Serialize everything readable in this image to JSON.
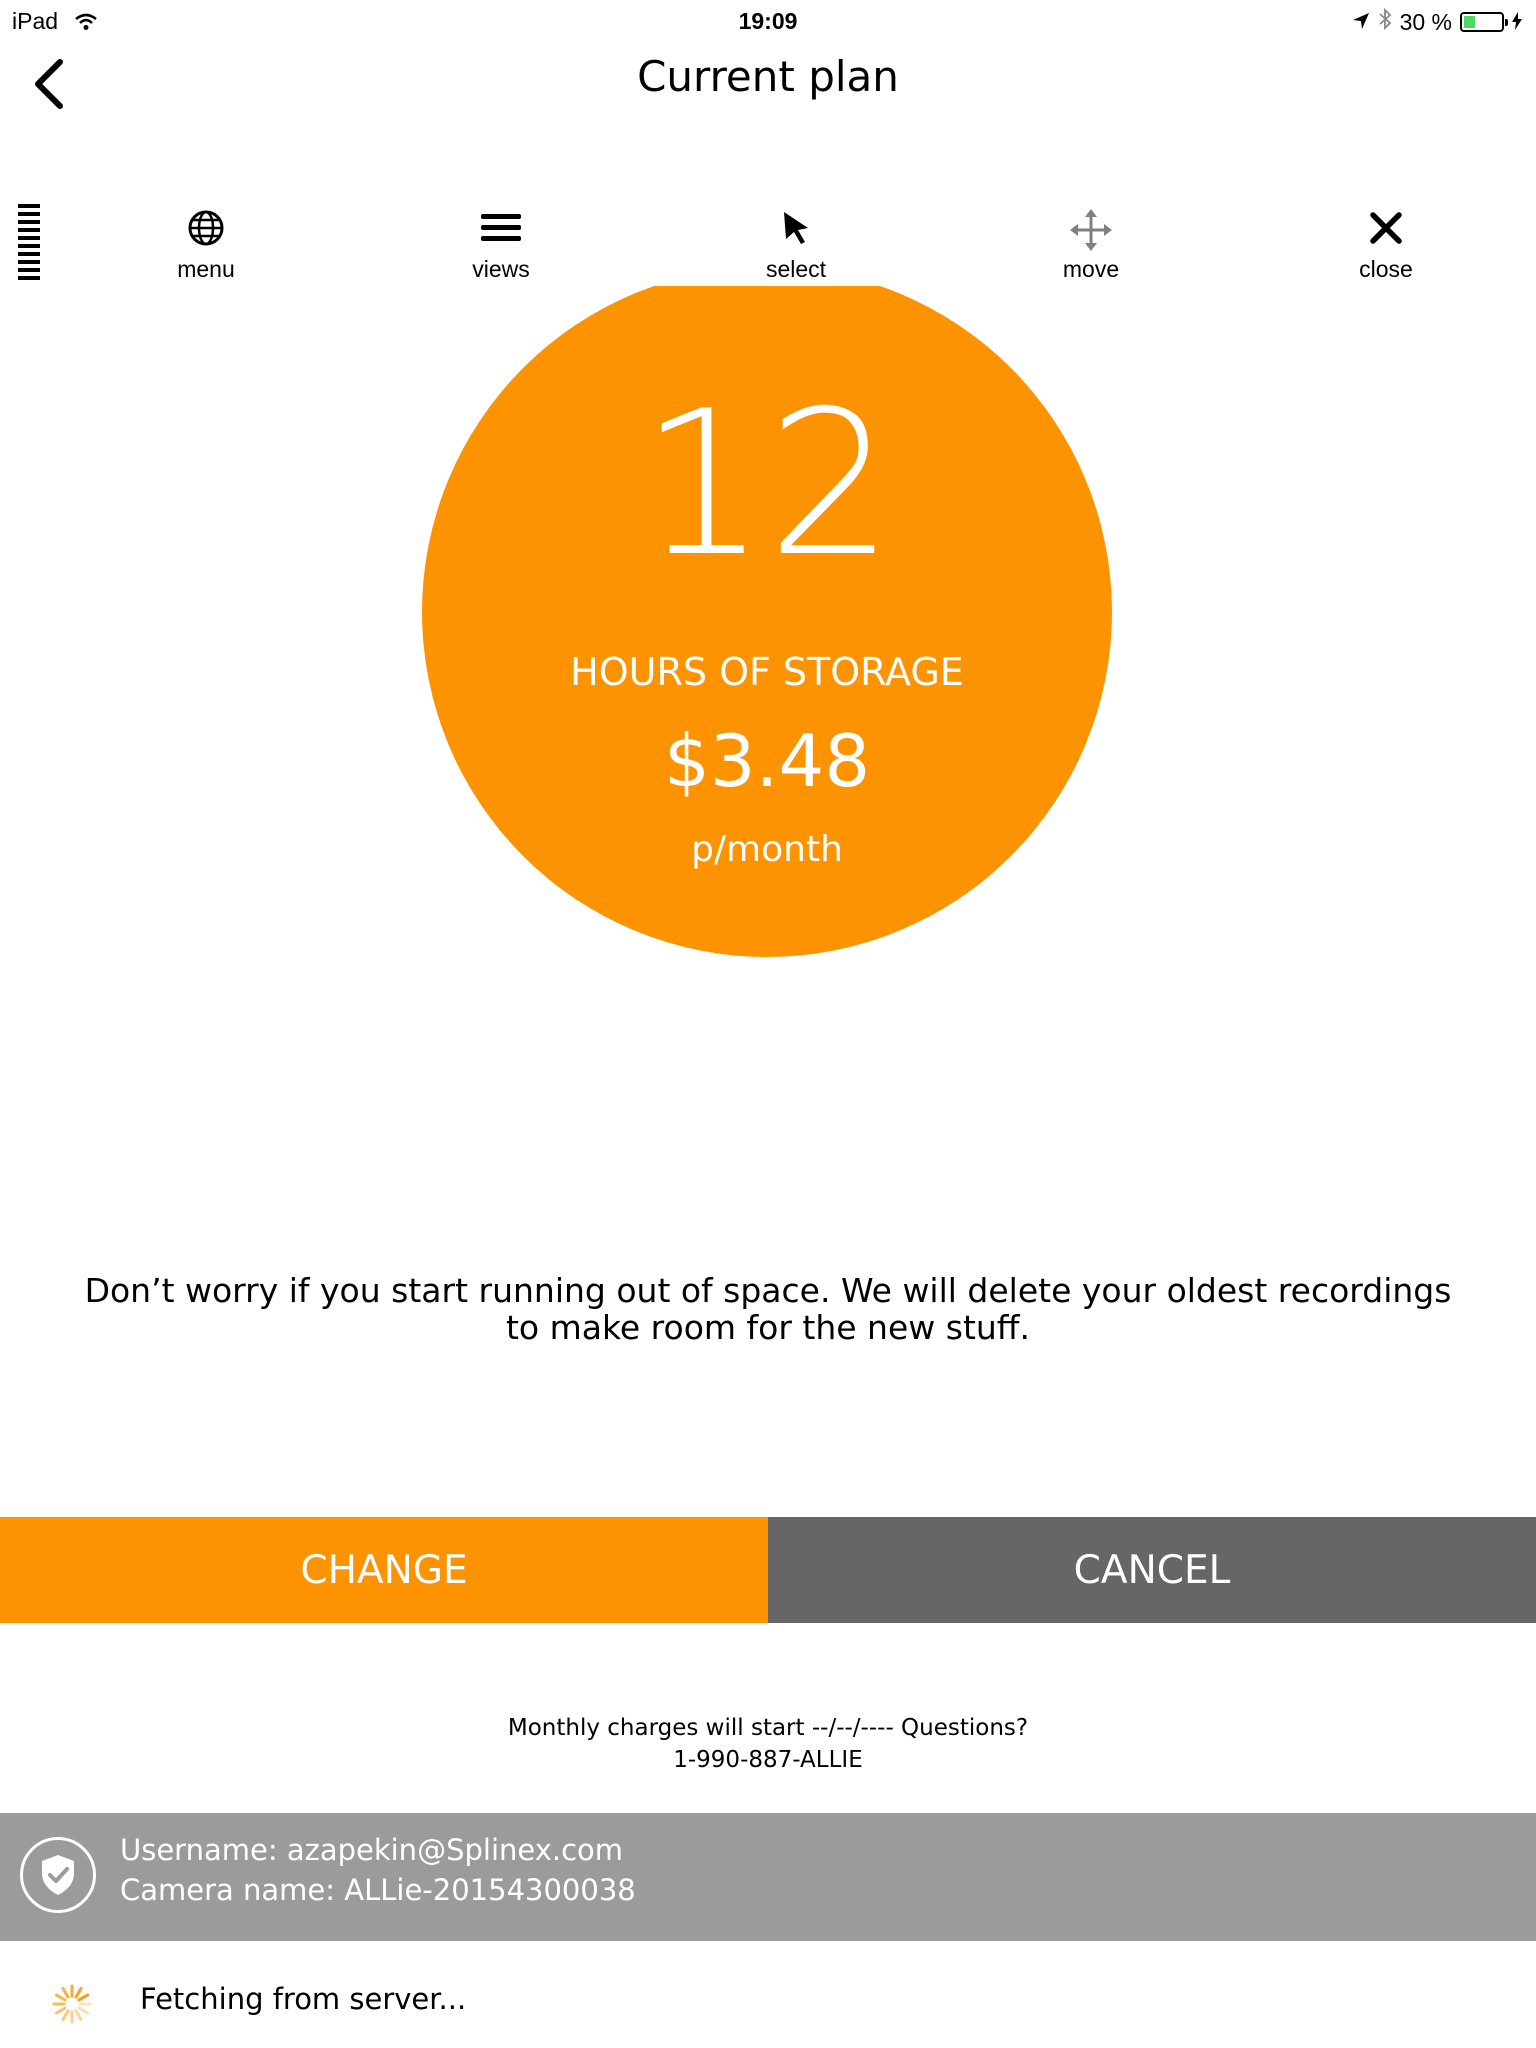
{
  "status_bar": {
    "device": "iPad",
    "time": "19:09",
    "battery": "30 %",
    "battery_level": 0.3,
    "icons": [
      "wifi-icon",
      "location-icon",
      "bluetooth-icon",
      "battery-icon",
      "charging-icon"
    ]
  },
  "nav": {
    "title": "Current plan",
    "back_icon": "chevron-left-icon"
  },
  "toolbar": {
    "items": [
      {
        "label": "menu",
        "icon": "globe-icon"
      },
      {
        "label": "views",
        "icon": "hamburger-icon"
      },
      {
        "label": "select",
        "icon": "cursor-arrow-icon"
      },
      {
        "label": "move",
        "icon": "move-arrows-icon"
      },
      {
        "label": "close",
        "icon": "close-icon"
      }
    ]
  },
  "plan": {
    "hours": "12",
    "hours_label": "HOURS OF STORAGE",
    "price": "$3.48",
    "period": "p/month"
  },
  "info_text_line1": "Don’t worry if you start running out of space. We will delete your oldest recordings",
  "info_text_line2": "to make room for the new stuff.",
  "buttons": {
    "change": "CHANGE",
    "cancel": "CANCEL"
  },
  "charges": {
    "line1": "Monthly charges will start --/--/---- Questions?",
    "line2": "1-990-887-ALLIE"
  },
  "account": {
    "username": "Username: azapekin@Splinex.com",
    "camera": "Camera name: ALLie-20154300038"
  },
  "footer": {
    "status": "Fetching from server..."
  },
  "colors": {
    "accent": "#fe9302",
    "cancel": "#656667",
    "account_bg": "#9b9b9b"
  }
}
